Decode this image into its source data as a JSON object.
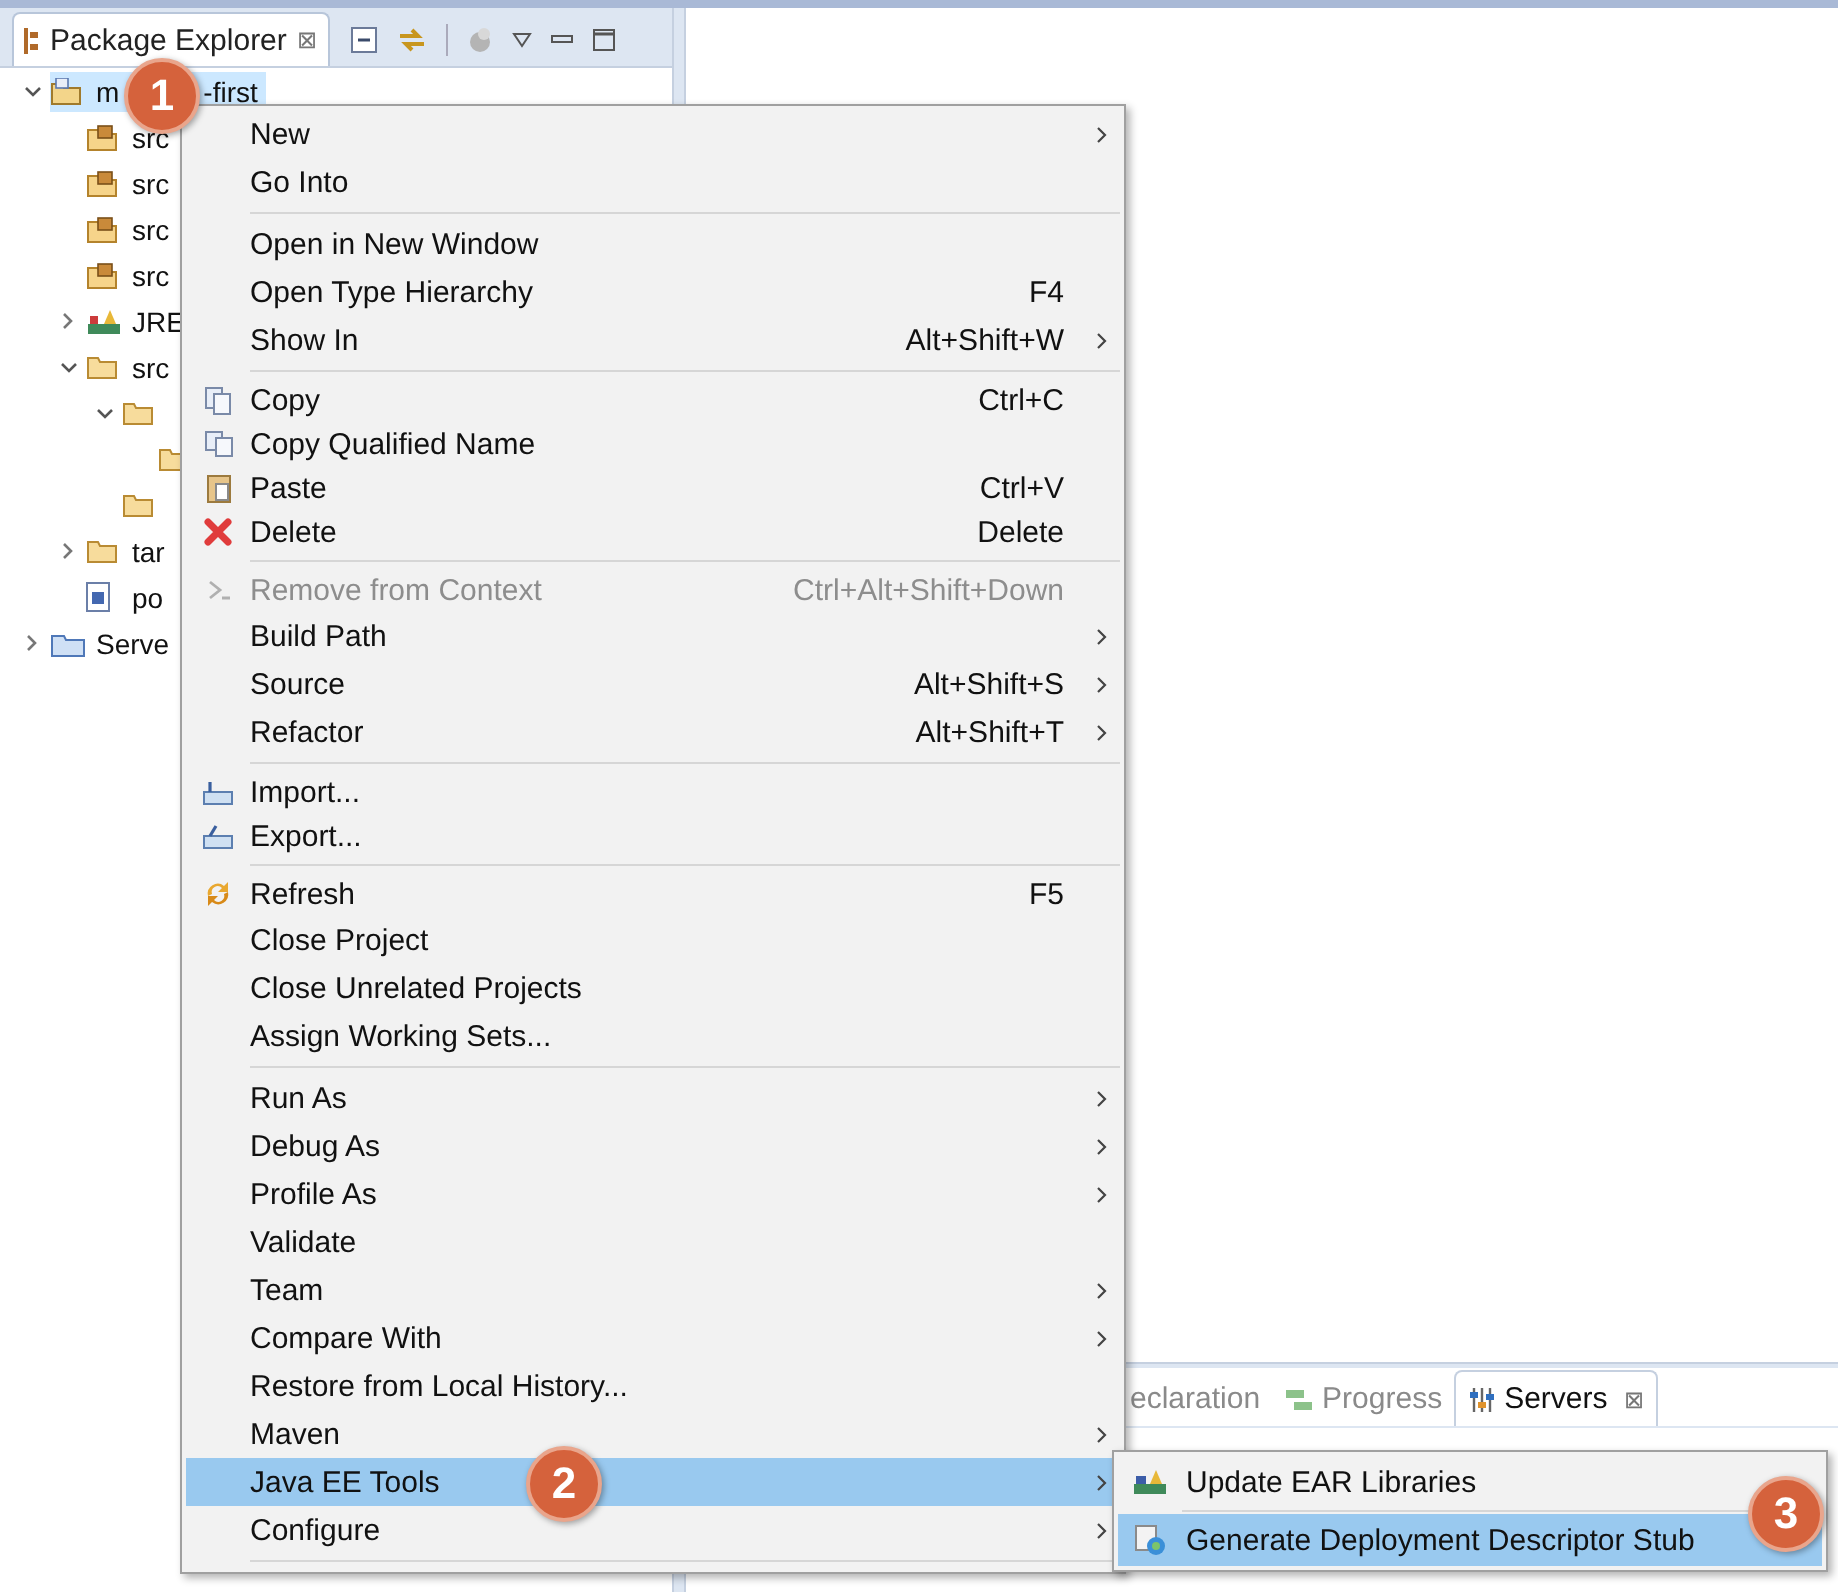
{
  "package_explorer": {
    "tab": {
      "title": "Package Explorer",
      "close": "⊠"
    },
    "tree": [
      {
        "label_parts": [
          "m",
          "-first"
        ],
        "kind": "project",
        "expanded": true,
        "selected": true,
        "children": [
          {
            "label_parts": [
              "src"
            ],
            "kind": "package-folder",
            "selected": false
          },
          {
            "label_parts": [
              "src"
            ],
            "kind": "package-folder",
            "selected": false
          },
          {
            "label_parts": [
              "src"
            ],
            "kind": "package-folder",
            "selected": false
          },
          {
            "label_parts": [
              "src"
            ],
            "kind": "package-folder",
            "selected": false
          },
          {
            "label_parts": [
              "JRE"
            ],
            "kind": "library",
            "expanded": false,
            "selected": false
          },
          {
            "label_parts": [
              "src"
            ],
            "kind": "folder",
            "expanded": true,
            "selected": false,
            "children": [
              {
                "kind": "folder",
                "expanded": true,
                "selected": false,
                "children": [
                  {
                    "kind": "folder",
                    "selected": false
                  }
                ]
              },
              {
                "kind": "folder",
                "selected": false
              }
            ]
          },
          {
            "label_parts": [
              "tar"
            ],
            "kind": "folder",
            "expanded": false,
            "selected": false
          },
          {
            "label_parts": [
              "po"
            ],
            "kind": "maven-file",
            "selected": false
          }
        ]
      },
      {
        "label_parts": [
          "Serve"
        ],
        "kind": "servers-folder",
        "expanded": false,
        "selected": false
      }
    ]
  },
  "context_menu": [
    {
      "kind": "plain",
      "label": "New",
      "submenu": true,
      "disabled": false,
      "selected": false
    },
    {
      "kind": "plain",
      "label": "Go Into",
      "submenu": false,
      "disabled": false,
      "selected": false
    },
    {
      "kind": "separator"
    },
    {
      "kind": "plain",
      "label": "Open in New Window",
      "submenu": false,
      "disabled": false,
      "selected": false
    },
    {
      "kind": "plain",
      "label": "Open Type Hierarchy",
      "shortcut": "F4",
      "submenu": false,
      "disabled": false,
      "selected": false
    },
    {
      "kind": "plain",
      "label": "Show In",
      "shortcut": "Alt+Shift+W",
      "submenu": true,
      "disabled": false,
      "selected": false
    },
    {
      "kind": "separator"
    },
    {
      "kind": "copy",
      "label": "Copy",
      "shortcut": "Ctrl+C",
      "submenu": false,
      "disabled": false,
      "selected": false
    },
    {
      "kind": "copy-qualified",
      "label": "Copy Qualified Name",
      "submenu": false,
      "disabled": false,
      "selected": false
    },
    {
      "kind": "paste",
      "label": "Paste",
      "shortcut": "Ctrl+V",
      "submenu": false,
      "disabled": false,
      "selected": false
    },
    {
      "kind": "delete",
      "label": "Delete",
      "shortcut": "Delete",
      "submenu": false,
      "disabled": false,
      "selected": false
    },
    {
      "kind": "separator"
    },
    {
      "kind": "remove-context",
      "label": "Remove from Context",
      "shortcut": "Ctrl+Alt+Shift+Down",
      "submenu": false,
      "disabled": true,
      "selected": false
    },
    {
      "kind": "plain",
      "label": "Build Path",
      "submenu": true,
      "disabled": false,
      "selected": false
    },
    {
      "kind": "plain",
      "label": "Source",
      "shortcut": "Alt+Shift+S",
      "submenu": true,
      "disabled": false,
      "selected": false
    },
    {
      "kind": "plain",
      "label": "Refactor",
      "shortcut": "Alt+Shift+T",
      "submenu": true,
      "disabled": false,
      "selected": false
    },
    {
      "kind": "separator"
    },
    {
      "kind": "import",
      "label": "Import...",
      "submenu": false,
      "disabled": false,
      "selected": false
    },
    {
      "kind": "export",
      "label": "Export...",
      "submenu": false,
      "disabled": false,
      "selected": false
    },
    {
      "kind": "separator"
    },
    {
      "kind": "refresh",
      "label": "Refresh",
      "shortcut": "F5",
      "submenu": false,
      "disabled": false,
      "selected": false
    },
    {
      "kind": "plain",
      "label": "Close Project",
      "submenu": false,
      "disabled": false,
      "selected": false
    },
    {
      "kind": "plain",
      "label": "Close Unrelated Projects",
      "submenu": false,
      "disabled": false,
      "selected": false
    },
    {
      "kind": "plain",
      "label": "Assign Working Sets...",
      "submenu": false,
      "disabled": false,
      "selected": false
    },
    {
      "kind": "separator"
    },
    {
      "kind": "plain",
      "label": "Run As",
      "submenu": true,
      "disabled": false,
      "selected": false
    },
    {
      "kind": "plain",
      "label": "Debug As",
      "submenu": true,
      "disabled": false,
      "selected": false
    },
    {
      "kind": "plain",
      "label": "Profile As",
      "submenu": true,
      "disabled": false,
      "selected": false
    },
    {
      "kind": "plain",
      "label": "Validate",
      "submenu": false,
      "disabled": false,
      "selected": false
    },
    {
      "kind": "plain",
      "label": "Team",
      "submenu": true,
      "disabled": false,
      "selected": false
    },
    {
      "kind": "plain",
      "label": "Compare With",
      "submenu": true,
      "disabled": false,
      "selected": false
    },
    {
      "kind": "plain",
      "label": "Restore from Local History...",
      "submenu": false,
      "disabled": false,
      "selected": false
    },
    {
      "kind": "plain",
      "label": "Maven",
      "submenu": true,
      "disabled": false,
      "selected": false
    },
    {
      "kind": "plain",
      "label": "Java EE Tools",
      "submenu": true,
      "disabled": false,
      "selected": true
    },
    {
      "kind": "plain",
      "label": "Configure",
      "submenu": true,
      "disabled": false,
      "selected": false
    },
    {
      "kind": "separator"
    }
  ],
  "submenu": [
    {
      "kind": "ear-libraries",
      "label": "Update EAR Libraries",
      "submenu": false,
      "disabled": false,
      "selected": false
    },
    {
      "kind": "separator"
    },
    {
      "kind": "deployment-descriptor",
      "label": "Generate Deployment Descriptor Stub",
      "submenu": false,
      "disabled": false,
      "selected": true
    }
  ],
  "bottom_panel": {
    "tabs": [
      {
        "label": "eclaration",
        "kind": "plain",
        "selected": false
      },
      {
        "label": "Progress",
        "kind": "progress",
        "selected": false
      },
      {
        "label": "Servers",
        "kind": "servers",
        "close": "⊠",
        "selected": true
      }
    ]
  },
  "step_badges": [
    "1",
    "2",
    "3"
  ]
}
